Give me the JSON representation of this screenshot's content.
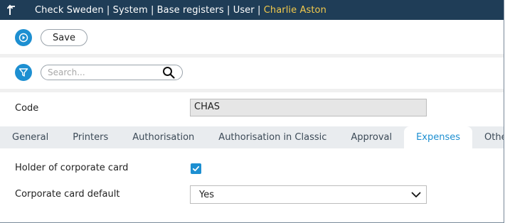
{
  "header": {
    "breadcrumb_text": "Check Sweden | System | Base registers | User | ",
    "user_name": "Charlie Aston",
    "back_icon": "back-arrow-icon",
    "bg_color": "#1f3d57",
    "accent_color": "#f2c94c"
  },
  "toolbar": {
    "run_icon": "play-icon",
    "save_label": "Save"
  },
  "search": {
    "filter_icon": "filter-icon",
    "placeholder": "Search...",
    "value": "",
    "search_icon": "search-icon"
  },
  "form": {
    "code_label": "Code",
    "code_value": "CHAS"
  },
  "tabs": [
    {
      "label": "General",
      "active": false
    },
    {
      "label": "Printers",
      "active": false
    },
    {
      "label": "Authorisation",
      "active": false
    },
    {
      "label": "Authorisation in Classic",
      "active": false
    },
    {
      "label": "Approval",
      "active": false
    },
    {
      "label": "Expenses",
      "active": true
    },
    {
      "label": "Other",
      "active": false
    }
  ],
  "expenses": {
    "holder_label": "Holder of corporate card",
    "holder_checked": true,
    "default_label": "Corporate card default",
    "default_value": "Yes"
  },
  "colors": {
    "primary": "#1d8fd1",
    "tab_bar": "#e9ecef"
  }
}
